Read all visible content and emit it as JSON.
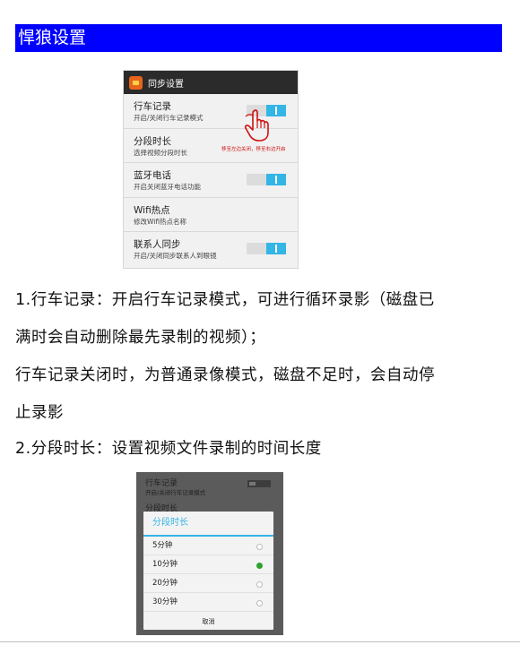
{
  "section_title": "悍狼设置",
  "settings_screen": {
    "header_title": "同步设置",
    "rows": [
      {
        "title": "行车记录",
        "subtitle": "开启/关闭行车记录模式",
        "toggle": "on"
      },
      {
        "title": "分段时长",
        "subtitle": "选择视频分段时长",
        "toggle": null
      },
      {
        "title": "蓝牙电话",
        "subtitle": "开启关闭蓝牙电话功能",
        "toggle": "on"
      },
      {
        "title": "Wifi热点",
        "subtitle": "修改Wifi热点名称",
        "toggle": null
      },
      {
        "title": "联系人同步",
        "subtitle": "开启/关闭同步联系人到眼镜",
        "toggle": "on"
      }
    ],
    "annotation": "移至左边关闭，移至右边开启",
    "accent_color": "#33b5e5",
    "annotation_color": "#d01010"
  },
  "paragraphs": [
    "1.行车记录：开启行车记录模式，可进行循环录影（磁盘已",
    "满时会自动删除最先录制的视频）；",
    "行车记录关闭时，为普通录像模式，磁盘不足时，会自动停",
    "止录影",
    "2.分段时长：设置视频文件录制的时间长度"
  ],
  "dialog_screen": {
    "background_title": "行车记录",
    "background_subtitle": "开启/关闭行车记录模式",
    "background_title2": "分段时长",
    "dialog_title": "分段时长",
    "options": [
      {
        "label": "5分钟",
        "selected": false
      },
      {
        "label": "10分钟",
        "selected": true
      },
      {
        "label": "20分钟",
        "selected": false
      },
      {
        "label": "30分钟",
        "selected": false
      }
    ],
    "cancel_label": "取消",
    "selected_color": "#2ea12e"
  },
  "banner_color": "#0000ff"
}
